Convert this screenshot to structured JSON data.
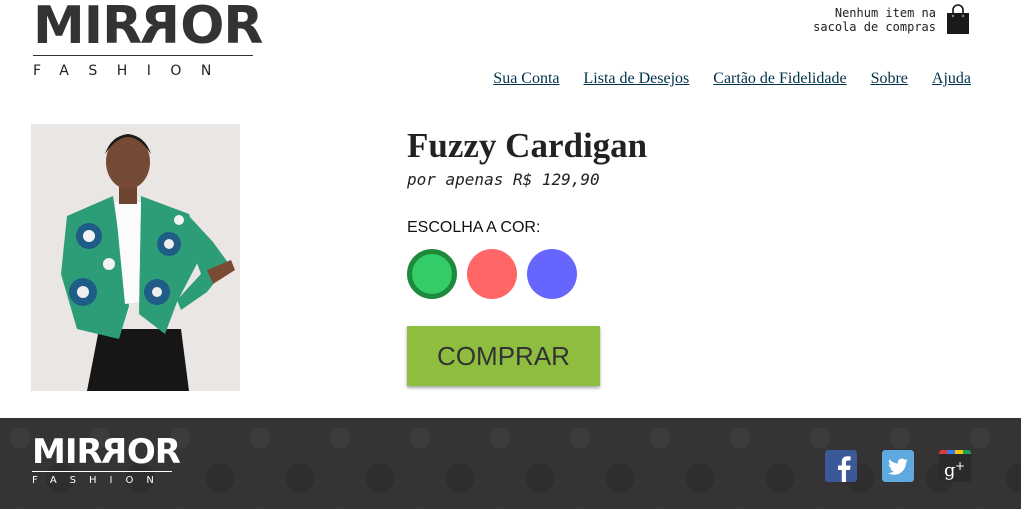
{
  "brand": {
    "name": "MIRROR",
    "tagline": "FASHION"
  },
  "cart": {
    "line1": "Nenhum item na",
    "line2": "sacola de compras",
    "icon": "shopping-bag-icon"
  },
  "nav": [
    {
      "label": "Sua Conta"
    },
    {
      "label": "Lista de Desejos"
    },
    {
      "label": "Cartão de Fidelidade"
    },
    {
      "label": "Sobre"
    },
    {
      "label": "Ajuda"
    }
  ],
  "product": {
    "name": "Fuzzy Cardigan",
    "price": "por apenas R$ 129,90",
    "color_label": "ESCOLHA A COR:",
    "colors": [
      {
        "name": "green",
        "hex": "#33cc66",
        "selected": true
      },
      {
        "name": "red",
        "hex": "#ff6666",
        "selected": false
      },
      {
        "name": "blue",
        "hex": "#6666ff",
        "selected": false
      }
    ],
    "buy_label": "COMPRAR",
    "buy_color": "#8fbd3f"
  },
  "footer": {
    "brand": "MIRROR",
    "tagline": "FASHION",
    "social": [
      "facebook-icon",
      "twitter-icon",
      "google-plus-icon"
    ]
  }
}
